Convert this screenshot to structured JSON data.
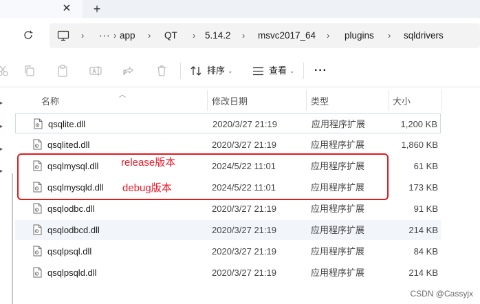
{
  "tabbar": {
    "close_glyph": "✕",
    "new_tab_glyph": "+"
  },
  "address": {
    "overflow": "···",
    "crumbs": [
      "app",
      "QT",
      "5.14.2",
      "msvc2017_64",
      "plugins",
      "sqldrivers"
    ]
  },
  "commandbar": {
    "sort_label": "排序",
    "view_label": "查看",
    "more_glyph": "···",
    "icons": [
      "cut-icon",
      "copy-icon",
      "paste-icon",
      "rename-icon",
      "share-icon",
      "delete-icon",
      "sort-icon",
      "view-icon"
    ]
  },
  "columns": {
    "name": "名称",
    "date": "修改日期",
    "type": "类型",
    "size": "大小"
  },
  "files": [
    {
      "name": "qsqlite.dll",
      "date": "2020/3/27 21:19",
      "type": "应用程序扩展",
      "size": "1,200 KB"
    },
    {
      "name": "qsqlited.dll",
      "date": "2020/3/27 21:19",
      "type": "应用程序扩展",
      "size": "1,860 KB"
    },
    {
      "name": "qsqlmysql.dll",
      "date": "2024/5/22 11:01",
      "type": "应用程序扩展",
      "size": "61 KB"
    },
    {
      "name": "qsqlmysqld.dll",
      "date": "2024/5/22 11:01",
      "type": "应用程序扩展",
      "size": "173 KB"
    },
    {
      "name": "qsqlodbc.dll",
      "date": "2020/3/27 21:19",
      "type": "应用程序扩展",
      "size": "91 KB"
    },
    {
      "name": "qsqlodbcd.dll",
      "date": "2020/3/27 21:19",
      "type": "应用程序扩展",
      "size": "214 KB"
    },
    {
      "name": "qsqlpsql.dll",
      "date": "2020/3/27 21:19",
      "type": "应用程序扩展",
      "size": "84 KB"
    },
    {
      "name": "qsqlpsqld.dll",
      "date": "2020/3/27 21:19",
      "type": "应用程序扩展",
      "size": "214 KB"
    }
  ],
  "annotations": {
    "release": "release版本",
    "debug": "debug版本",
    "color": "#e0191a"
  },
  "watermark": "CSDN @Cassyjx"
}
